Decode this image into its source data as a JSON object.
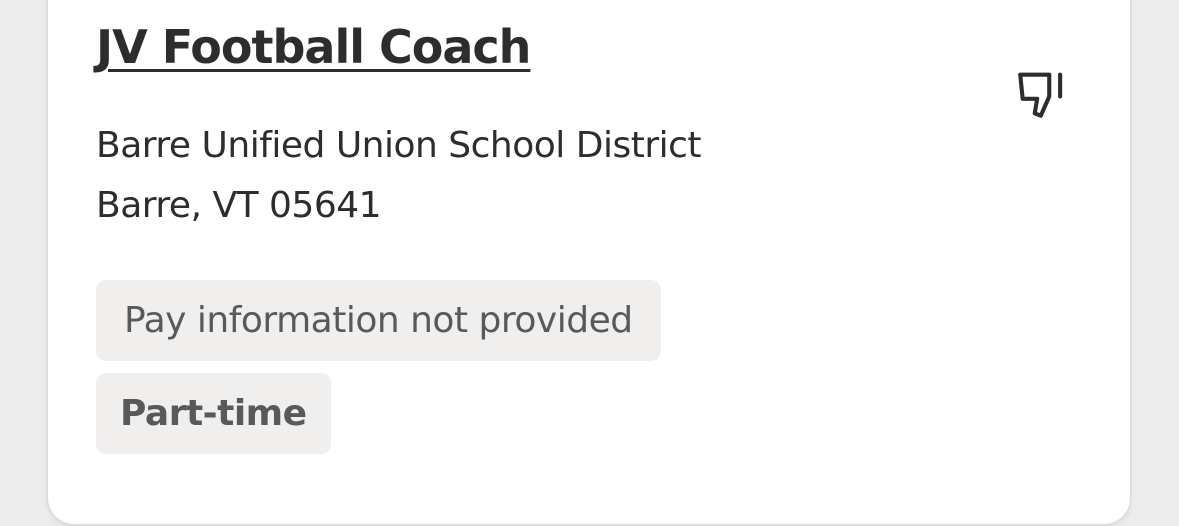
{
  "job": {
    "title": "JV Football Coach",
    "company": "Barre Unified Union School District",
    "location": "Barre, VT 05641",
    "tags": {
      "pay": "Pay information not provided",
      "job_type": "Part-time"
    },
    "actions": {
      "dislike_icon": "thumbs-down-icon"
    }
  },
  "colors": {
    "text_primary": "#2d2d2d",
    "tag_background": "#f1efee",
    "tag_text": "#595959",
    "card_background": "#ffffff"
  }
}
